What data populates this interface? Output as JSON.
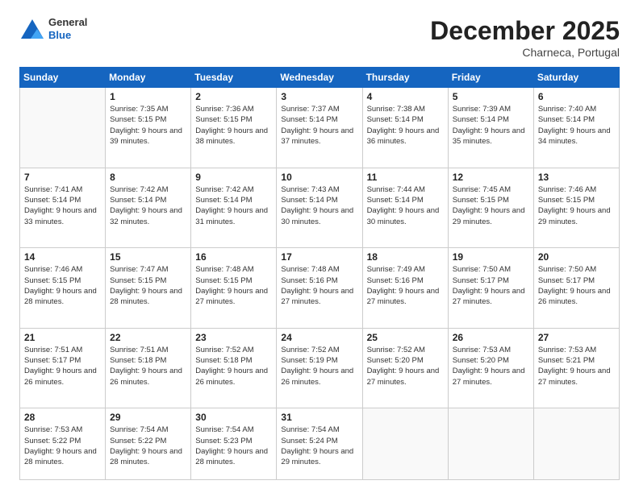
{
  "header": {
    "logo": {
      "general": "General",
      "blue": "Blue"
    },
    "title": "December 2025",
    "location": "Charneca, Portugal"
  },
  "days_of_week": [
    "Sunday",
    "Monday",
    "Tuesday",
    "Wednesday",
    "Thursday",
    "Friday",
    "Saturday"
  ],
  "weeks": [
    [
      {
        "num": "",
        "empty": true
      },
      {
        "num": "1",
        "sunrise": "Sunrise: 7:35 AM",
        "sunset": "Sunset: 5:15 PM",
        "daylight": "Daylight: 9 hours and 39 minutes."
      },
      {
        "num": "2",
        "sunrise": "Sunrise: 7:36 AM",
        "sunset": "Sunset: 5:15 PM",
        "daylight": "Daylight: 9 hours and 38 minutes."
      },
      {
        "num": "3",
        "sunrise": "Sunrise: 7:37 AM",
        "sunset": "Sunset: 5:14 PM",
        "daylight": "Daylight: 9 hours and 37 minutes."
      },
      {
        "num": "4",
        "sunrise": "Sunrise: 7:38 AM",
        "sunset": "Sunset: 5:14 PM",
        "daylight": "Daylight: 9 hours and 36 minutes."
      },
      {
        "num": "5",
        "sunrise": "Sunrise: 7:39 AM",
        "sunset": "Sunset: 5:14 PM",
        "daylight": "Daylight: 9 hours and 35 minutes."
      },
      {
        "num": "6",
        "sunrise": "Sunrise: 7:40 AM",
        "sunset": "Sunset: 5:14 PM",
        "daylight": "Daylight: 9 hours and 34 minutes."
      }
    ],
    [
      {
        "num": "7",
        "sunrise": "Sunrise: 7:41 AM",
        "sunset": "Sunset: 5:14 PM",
        "daylight": "Daylight: 9 hours and 33 minutes."
      },
      {
        "num": "8",
        "sunrise": "Sunrise: 7:42 AM",
        "sunset": "Sunset: 5:14 PM",
        "daylight": "Daylight: 9 hours and 32 minutes."
      },
      {
        "num": "9",
        "sunrise": "Sunrise: 7:42 AM",
        "sunset": "Sunset: 5:14 PM",
        "daylight": "Daylight: 9 hours and 31 minutes."
      },
      {
        "num": "10",
        "sunrise": "Sunrise: 7:43 AM",
        "sunset": "Sunset: 5:14 PM",
        "daylight": "Daylight: 9 hours and 30 minutes."
      },
      {
        "num": "11",
        "sunrise": "Sunrise: 7:44 AM",
        "sunset": "Sunset: 5:14 PM",
        "daylight": "Daylight: 9 hours and 30 minutes."
      },
      {
        "num": "12",
        "sunrise": "Sunrise: 7:45 AM",
        "sunset": "Sunset: 5:15 PM",
        "daylight": "Daylight: 9 hours and 29 minutes."
      },
      {
        "num": "13",
        "sunrise": "Sunrise: 7:46 AM",
        "sunset": "Sunset: 5:15 PM",
        "daylight": "Daylight: 9 hours and 29 minutes."
      }
    ],
    [
      {
        "num": "14",
        "sunrise": "Sunrise: 7:46 AM",
        "sunset": "Sunset: 5:15 PM",
        "daylight": "Daylight: 9 hours and 28 minutes."
      },
      {
        "num": "15",
        "sunrise": "Sunrise: 7:47 AM",
        "sunset": "Sunset: 5:15 PM",
        "daylight": "Daylight: 9 hours and 28 minutes."
      },
      {
        "num": "16",
        "sunrise": "Sunrise: 7:48 AM",
        "sunset": "Sunset: 5:15 PM",
        "daylight": "Daylight: 9 hours and 27 minutes."
      },
      {
        "num": "17",
        "sunrise": "Sunrise: 7:48 AM",
        "sunset": "Sunset: 5:16 PM",
        "daylight": "Daylight: 9 hours and 27 minutes."
      },
      {
        "num": "18",
        "sunrise": "Sunrise: 7:49 AM",
        "sunset": "Sunset: 5:16 PM",
        "daylight": "Daylight: 9 hours and 27 minutes."
      },
      {
        "num": "19",
        "sunrise": "Sunrise: 7:50 AM",
        "sunset": "Sunset: 5:17 PM",
        "daylight": "Daylight: 9 hours and 27 minutes."
      },
      {
        "num": "20",
        "sunrise": "Sunrise: 7:50 AM",
        "sunset": "Sunset: 5:17 PM",
        "daylight": "Daylight: 9 hours and 26 minutes."
      }
    ],
    [
      {
        "num": "21",
        "sunrise": "Sunrise: 7:51 AM",
        "sunset": "Sunset: 5:17 PM",
        "daylight": "Daylight: 9 hours and 26 minutes."
      },
      {
        "num": "22",
        "sunrise": "Sunrise: 7:51 AM",
        "sunset": "Sunset: 5:18 PM",
        "daylight": "Daylight: 9 hours and 26 minutes."
      },
      {
        "num": "23",
        "sunrise": "Sunrise: 7:52 AM",
        "sunset": "Sunset: 5:18 PM",
        "daylight": "Daylight: 9 hours and 26 minutes."
      },
      {
        "num": "24",
        "sunrise": "Sunrise: 7:52 AM",
        "sunset": "Sunset: 5:19 PM",
        "daylight": "Daylight: 9 hours and 26 minutes."
      },
      {
        "num": "25",
        "sunrise": "Sunrise: 7:52 AM",
        "sunset": "Sunset: 5:20 PM",
        "daylight": "Daylight: 9 hours and 27 minutes."
      },
      {
        "num": "26",
        "sunrise": "Sunrise: 7:53 AM",
        "sunset": "Sunset: 5:20 PM",
        "daylight": "Daylight: 9 hours and 27 minutes."
      },
      {
        "num": "27",
        "sunrise": "Sunrise: 7:53 AM",
        "sunset": "Sunset: 5:21 PM",
        "daylight": "Daylight: 9 hours and 27 minutes."
      }
    ],
    [
      {
        "num": "28",
        "sunrise": "Sunrise: 7:53 AM",
        "sunset": "Sunset: 5:22 PM",
        "daylight": "Daylight: 9 hours and 28 minutes."
      },
      {
        "num": "29",
        "sunrise": "Sunrise: 7:54 AM",
        "sunset": "Sunset: 5:22 PM",
        "daylight": "Daylight: 9 hours and 28 minutes."
      },
      {
        "num": "30",
        "sunrise": "Sunrise: 7:54 AM",
        "sunset": "Sunset: 5:23 PM",
        "daylight": "Daylight: 9 hours and 28 minutes."
      },
      {
        "num": "31",
        "sunrise": "Sunrise: 7:54 AM",
        "sunset": "Sunset: 5:24 PM",
        "daylight": "Daylight: 9 hours and 29 minutes."
      },
      {
        "num": "",
        "empty": true
      },
      {
        "num": "",
        "empty": true
      },
      {
        "num": "",
        "empty": true
      }
    ]
  ]
}
